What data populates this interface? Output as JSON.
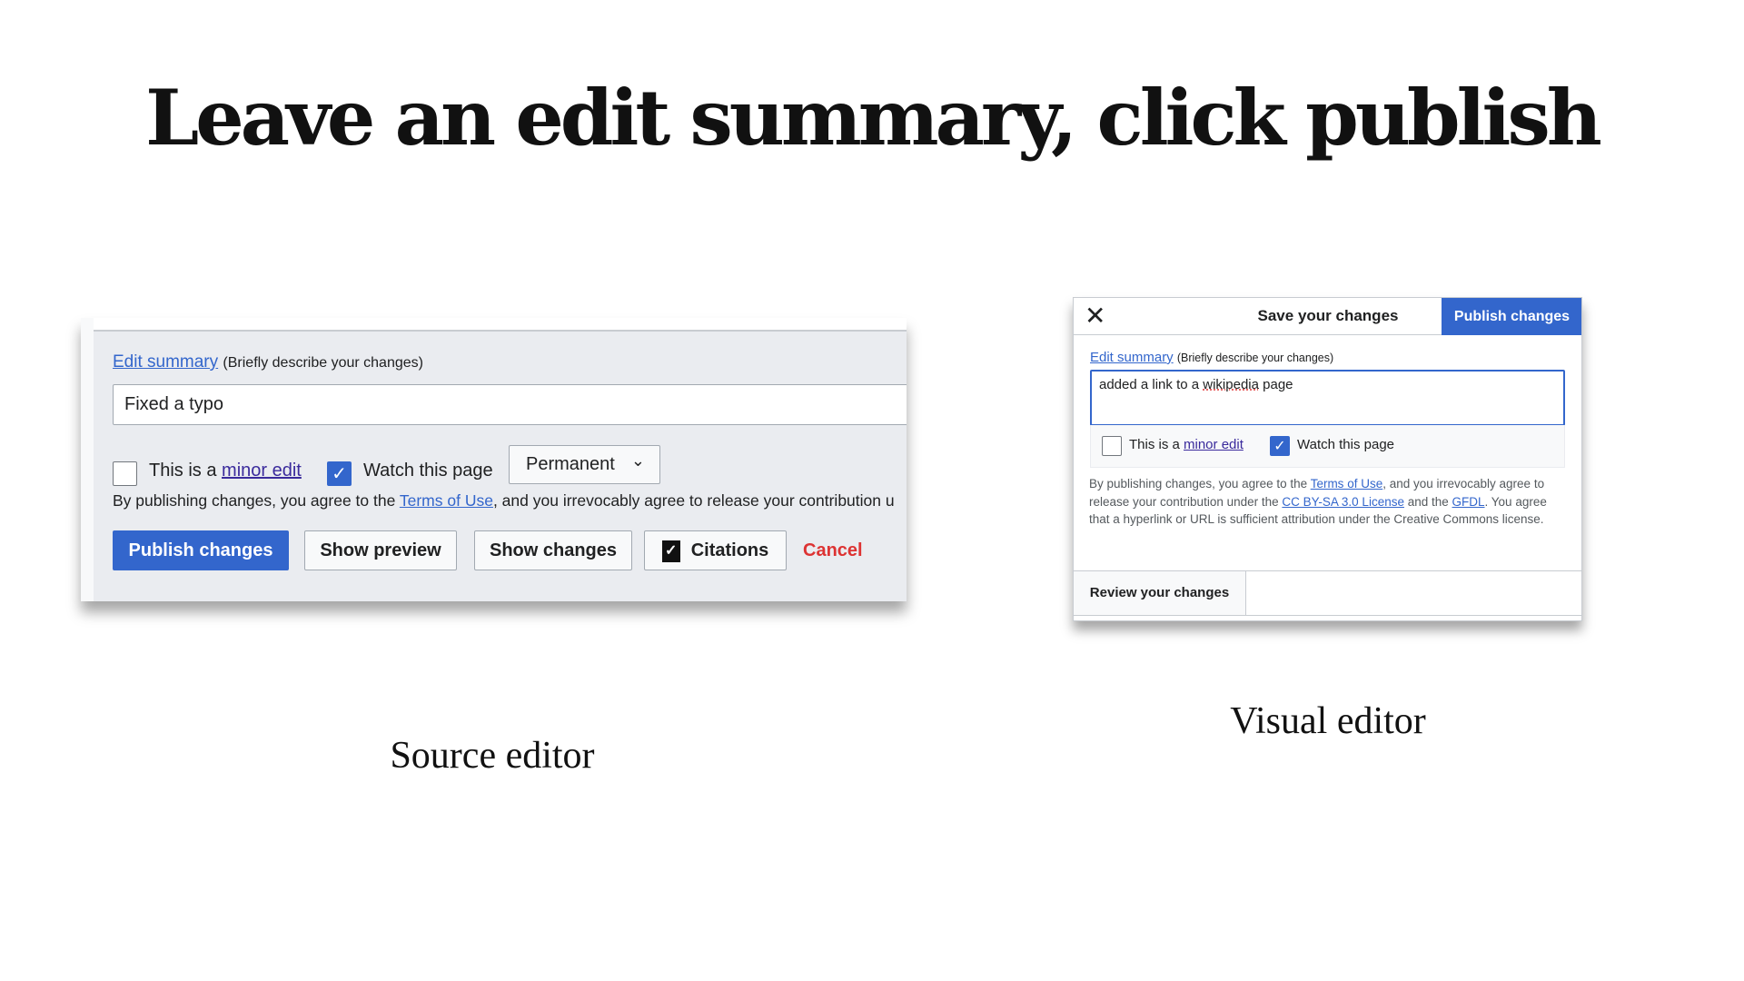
{
  "title": "Leave an edit summary, click publish",
  "captions": {
    "source": "Source editor",
    "visual": "Visual editor"
  },
  "source_editor": {
    "edit_summary_link": "Edit summary",
    "edit_summary_hint": "(Briefly describe your changes)",
    "summary_value": "Fixed a typo",
    "minor_prefix": "This is a ",
    "minor_link": "minor edit",
    "minor_checked": false,
    "watch_label": "Watch this page",
    "watch_checked": true,
    "watch_period": "Permanent",
    "terms_prefix": "By publishing changes, you agree to the ",
    "terms_link": "Terms of Use",
    "terms_suffix": ", and you irrevocably agree to release your contribution u",
    "buttons": {
      "publish": "Publish changes",
      "preview": "Show preview",
      "changes": "Show changes",
      "citations": "Citations",
      "cancel": "Cancel"
    }
  },
  "visual_editor": {
    "close_icon": "close-icon",
    "title": "Save your changes",
    "publish": "Publish changes",
    "edit_summary_link": "Edit summary",
    "edit_summary_hint": "(Briefly describe your changes)",
    "summary_parts": [
      "added a link to a ",
      "wikipedia",
      " page"
    ],
    "minor_prefix": "This is a ",
    "minor_link": "minor edit",
    "minor_checked": false,
    "watch_label": "Watch this page",
    "watch_checked": true,
    "terms": {
      "t1": "By publishing changes, you agree to the ",
      "l1": "Terms of Use",
      "t2": ", and you irrevocably agree to release your contribution under the ",
      "l2": "CC BY-SA 3.0 License",
      "t3": " and the ",
      "l3": "GFDL",
      "t4": ". You agree that a hyperlink or URL is sufficient attribution under the Creative Commons license."
    },
    "review": "Review your changes"
  },
  "colors": {
    "accent": "#3366cc",
    "cancel": "#dd3333"
  }
}
